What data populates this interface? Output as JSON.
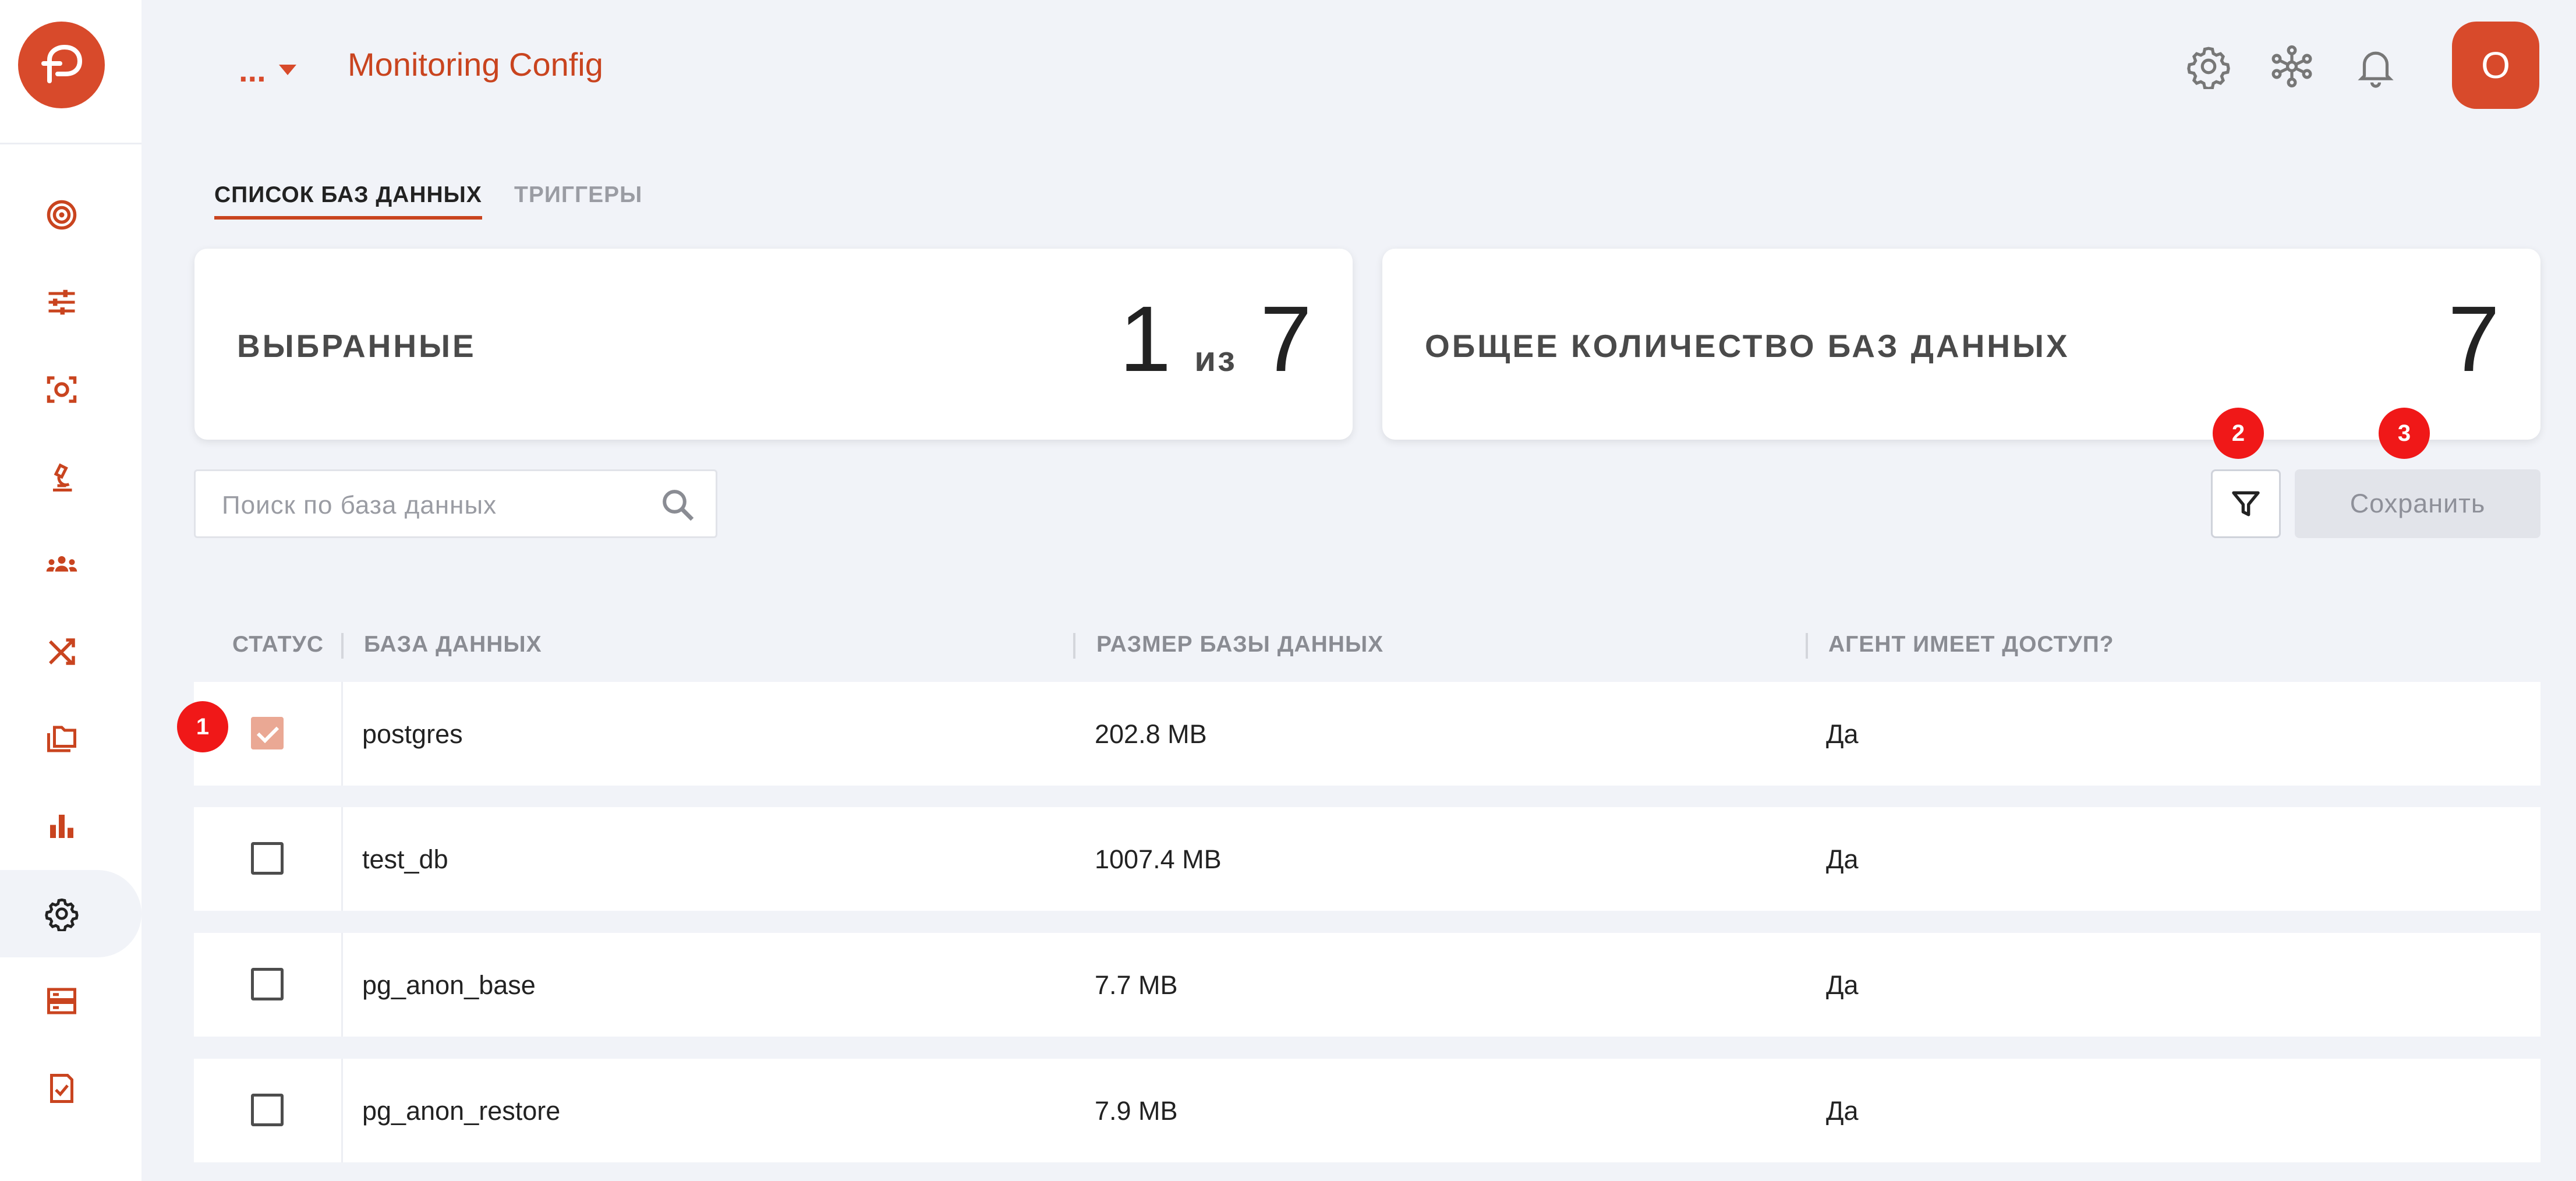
{
  "header": {
    "breadcrumb": "...",
    "title": "Monitoring Config"
  },
  "header_icons": [
    "gear-icon",
    "cluster-network-icon",
    "bell-icon"
  ],
  "user": {
    "avatar_letter": "O"
  },
  "sidebar": {
    "items": [
      {
        "icon": "target-icon",
        "active": false
      },
      {
        "icon": "sliders-icon",
        "active": false
      },
      {
        "icon": "focus-scan-icon",
        "active": false
      },
      {
        "icon": "microscope-icon",
        "active": false
      },
      {
        "icon": "users-group-icon",
        "active": false
      },
      {
        "icon": "shuffle-icon",
        "active": false
      },
      {
        "icon": "folders-icon",
        "active": false
      },
      {
        "icon": "bar-chart-icon",
        "active": false
      },
      {
        "icon": "settings-icon",
        "active": true
      },
      {
        "icon": "server-icon",
        "active": false
      },
      {
        "icon": "checklist-icon",
        "active": false
      }
    ]
  },
  "tabs": [
    {
      "label": "СПИСОК БАЗ ДАННЫХ",
      "active": true
    },
    {
      "label": "ТРИГГЕРЫ",
      "active": false
    }
  ],
  "stats": {
    "selected": {
      "label": "ВЫБРАННЫЕ",
      "value": "1",
      "of": "из",
      "total": "7"
    },
    "total": {
      "label": "ОБЩЕЕ КОЛИЧЕСТВО БАЗ ДАННЫХ",
      "value": "7"
    }
  },
  "search": {
    "placeholder": "Поиск по база данных",
    "value": ""
  },
  "toolbar": {
    "save_label": "Сохранить"
  },
  "markers": [
    "1",
    "2",
    "3"
  ],
  "table": {
    "columns": [
      "СТАТУС",
      "БАЗА ДАННЫХ",
      "РАЗМЕР БАЗЫ ДАННЫХ",
      "АГЕНТ ИМЕЕТ ДОСТУП?"
    ],
    "rows": [
      {
        "checked": true,
        "name": "postgres",
        "size": "202.8 MB",
        "access": "Да"
      },
      {
        "checked": false,
        "name": "test_db",
        "size": "1007.4 MB",
        "access": "Да"
      },
      {
        "checked": false,
        "name": "pg_anon_base",
        "size": "7.7 MB",
        "access": "Да"
      },
      {
        "checked": false,
        "name": "pg_anon_restore",
        "size": "7.9 MB",
        "access": "Да"
      }
    ]
  },
  "colors": {
    "accent": "#d84a2b",
    "background": "#f1f3f8",
    "marker": "#f01818",
    "checkbox_checked": "#eaa894"
  }
}
